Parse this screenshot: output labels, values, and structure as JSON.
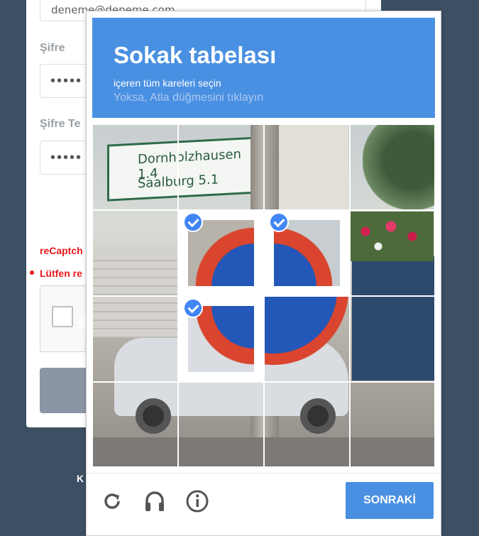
{
  "form": {
    "email_value": "deneme@deneme.com",
    "password_label": "Şifre",
    "password_masked": "•••••",
    "password_repeat_label": "Şifre Te",
    "password_repeat_masked": "•••••",
    "recaptcha_error": "reCaptch",
    "required_error": "Lütfen re",
    "footer_partial": "K"
  },
  "challenge": {
    "title": "Sokak tabelası",
    "subtitle": "içeren tüm kareleri seçin",
    "hint": "Yoksa, Atla düğmesini tıklayın",
    "grid": {
      "rows": 4,
      "cols": 4,
      "selected_tiles": [
        [
          1,
          1
        ],
        [
          1,
          2
        ],
        [
          2,
          1
        ]
      ]
    },
    "sign_text_1": "Dornholzhausen 1.4",
    "sign_text_2": "Saalburg 5.1",
    "next_label": "SONRAKİ",
    "icons": [
      "reload-icon",
      "audio-icon",
      "info-icon"
    ]
  },
  "colors": {
    "accent": "#4a90e2",
    "error": "#e8191c",
    "page_bg": "#3d4f62"
  }
}
